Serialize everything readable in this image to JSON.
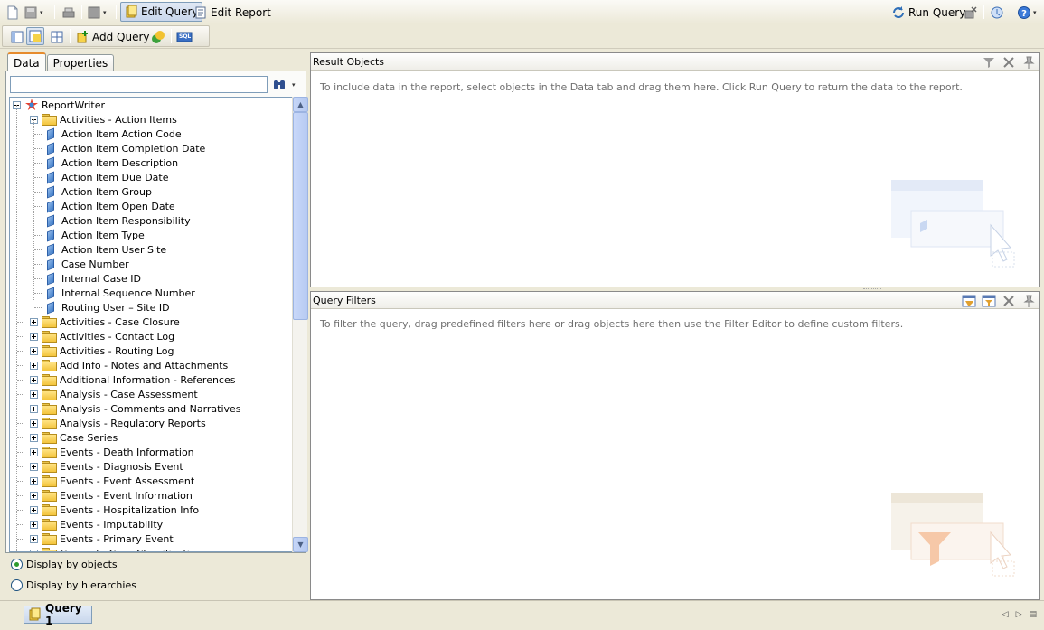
{
  "toolbar": {
    "edit_query": "Edit Query",
    "edit_report": "Edit Report",
    "run_query": "Run Query",
    "add_query": "Add Query",
    "sql_badge": "SQL"
  },
  "left_panel": {
    "tabs": [
      {
        "label": "Data",
        "active": true
      },
      {
        "label": "Properties",
        "active": false
      }
    ],
    "search_placeholder": "",
    "tree": {
      "root": "ReportWriter",
      "expanded_folder": "Activities - Action Items",
      "expanded_items": [
        "Action Item Action Code",
        "Action Item Completion Date",
        "Action Item Description",
        "Action Item Due Date",
        "Action Item Group",
        "Action Item Open Date",
        "Action Item Responsibility",
        "Action Item Type",
        "Action Item User Site",
        "Case Number",
        "Internal Case ID",
        "Internal Sequence Number",
        "Routing User – Site ID"
      ],
      "folders": [
        "Activities - Case Closure",
        "Activities - Contact Log",
        "Activities - Routing Log",
        "Add Info - Notes and Attachments",
        "Additional Information - References",
        "Analysis - Case Assessment",
        "Analysis - Comments and Narratives",
        "Analysis - Regulatory Reports",
        "Case Series",
        "Events - Death Information",
        "Events - Diagnosis Event",
        "Events - Event Assessment",
        "Events - Event Information",
        "Events - Hospitalization Info",
        "Events - Imputability",
        "Events - Primary Event",
        "General - Case Classifications"
      ]
    },
    "display_options": [
      {
        "label": "Display by objects",
        "selected": true
      },
      {
        "label": "Display by hierarchies",
        "selected": false
      }
    ]
  },
  "result_objects": {
    "title": "Result Objects",
    "hint": "To include data in the report, select objects in the Data tab and drag them here. Click Run Query to return the data to the report."
  },
  "query_filters": {
    "title": "Query Filters",
    "hint": "To filter the query, drag predefined filters here or drag objects here then use the Filter Editor to define custom filters."
  },
  "bottom": {
    "query_tab": "Query 1"
  },
  "colors": {
    "accent_blue": "#316ac5",
    "tab_highlight": "#e68b2c",
    "folder_yellow": "#f3c43c"
  }
}
